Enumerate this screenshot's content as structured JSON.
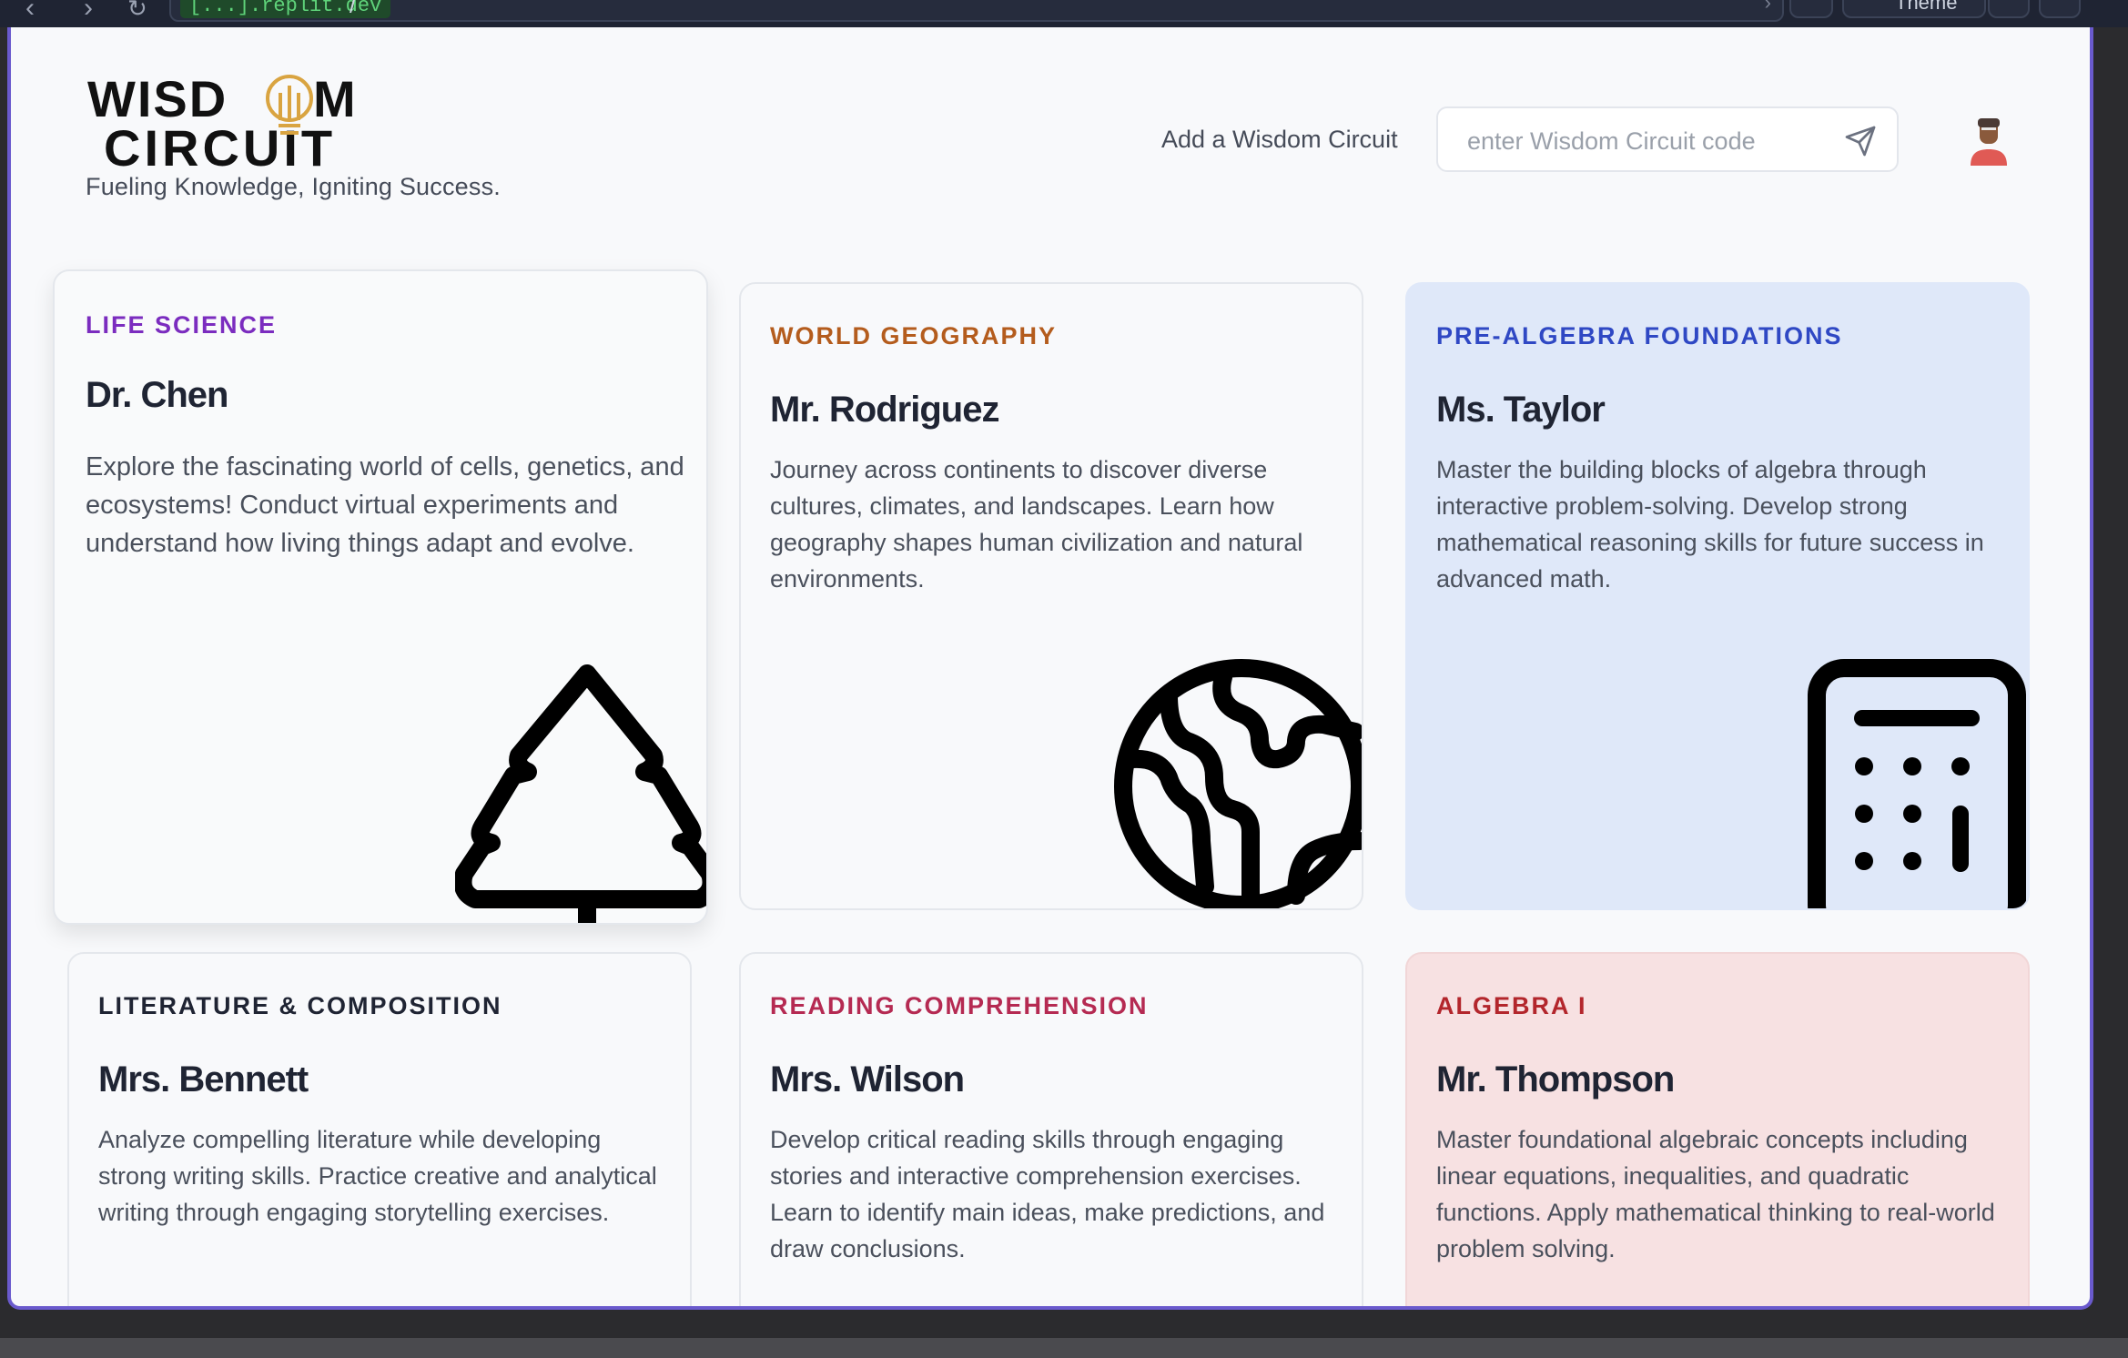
{
  "browser": {
    "domain": "[...].replit.dev",
    "path": "/",
    "theme_label": "Theme"
  },
  "header": {
    "tagline": "Fueling Knowledge, Igniting Success.",
    "logo_text_line1": "WISDOM",
    "logo_text_line2": "CIRCUIT",
    "add_label": "Add a Wisdom Circuit",
    "code_placeholder": "enter Wisdom Circuit code",
    "code_value": ""
  },
  "colors": {
    "accent_frame": "#6a5acd",
    "logo_gold": "#d9a441"
  },
  "cards": [
    {
      "subject": "LIFE SCIENCE",
      "subject_color": "#7b2cbf",
      "teacher": "Dr. Chen",
      "description": "Explore the fascinating world of cells, genetics, and ecosystems! Conduct virtual experiments and understand how living things adapt and evolve.",
      "icon": "tree-icon",
      "background": "#f9fafb"
    },
    {
      "subject": "WORLD GEOGRAPHY",
      "subject_color": "#b45c1d",
      "teacher": "Mr. Rodriguez",
      "description": "Journey across continents to discover diverse cultures, climates, and landscapes. Learn how geography shapes human civilization and natural environments.",
      "icon": "globe-icon",
      "background": "#f8f9fb"
    },
    {
      "subject": "PRE-ALGEBRA FOUNDATIONS",
      "subject_color": "#2f48c4",
      "teacher": "Ms. Taylor",
      "description": "Master the building blocks of algebra through interactive problem-solving. Develop strong mathematical reasoning skills for future success in advanced math.",
      "icon": "calculator-icon",
      "background": "#dfe8f9"
    },
    {
      "subject": "LITERATURE & COMPOSITION",
      "subject_color": "#1f2433",
      "teacher": "Mrs. Bennett",
      "description": "Analyze compelling literature while developing strong writing skills. Practice creative and analytical writing through engaging storytelling exercises.",
      "icon": "",
      "background": "#f8f9fb"
    },
    {
      "subject": "READING COMPREHENSION",
      "subject_color": "#b52a52",
      "teacher": "Mrs. Wilson",
      "description": "Develop critical reading skills through engaging stories and interactive comprehension exercises. Learn to identify main ideas, make predictions, and draw conclusions.",
      "icon": "",
      "background": "#f8f9fb"
    },
    {
      "subject": "ALGEBRA I",
      "subject_color": "#b3262c",
      "teacher": "Mr. Thompson",
      "description": "Master foundational algebraic concepts including linear equations, inequalities, and quadratic functions. Apply mathematical thinking to real-world problem solving.",
      "icon": "",
      "background": "#f7e1e2"
    }
  ]
}
